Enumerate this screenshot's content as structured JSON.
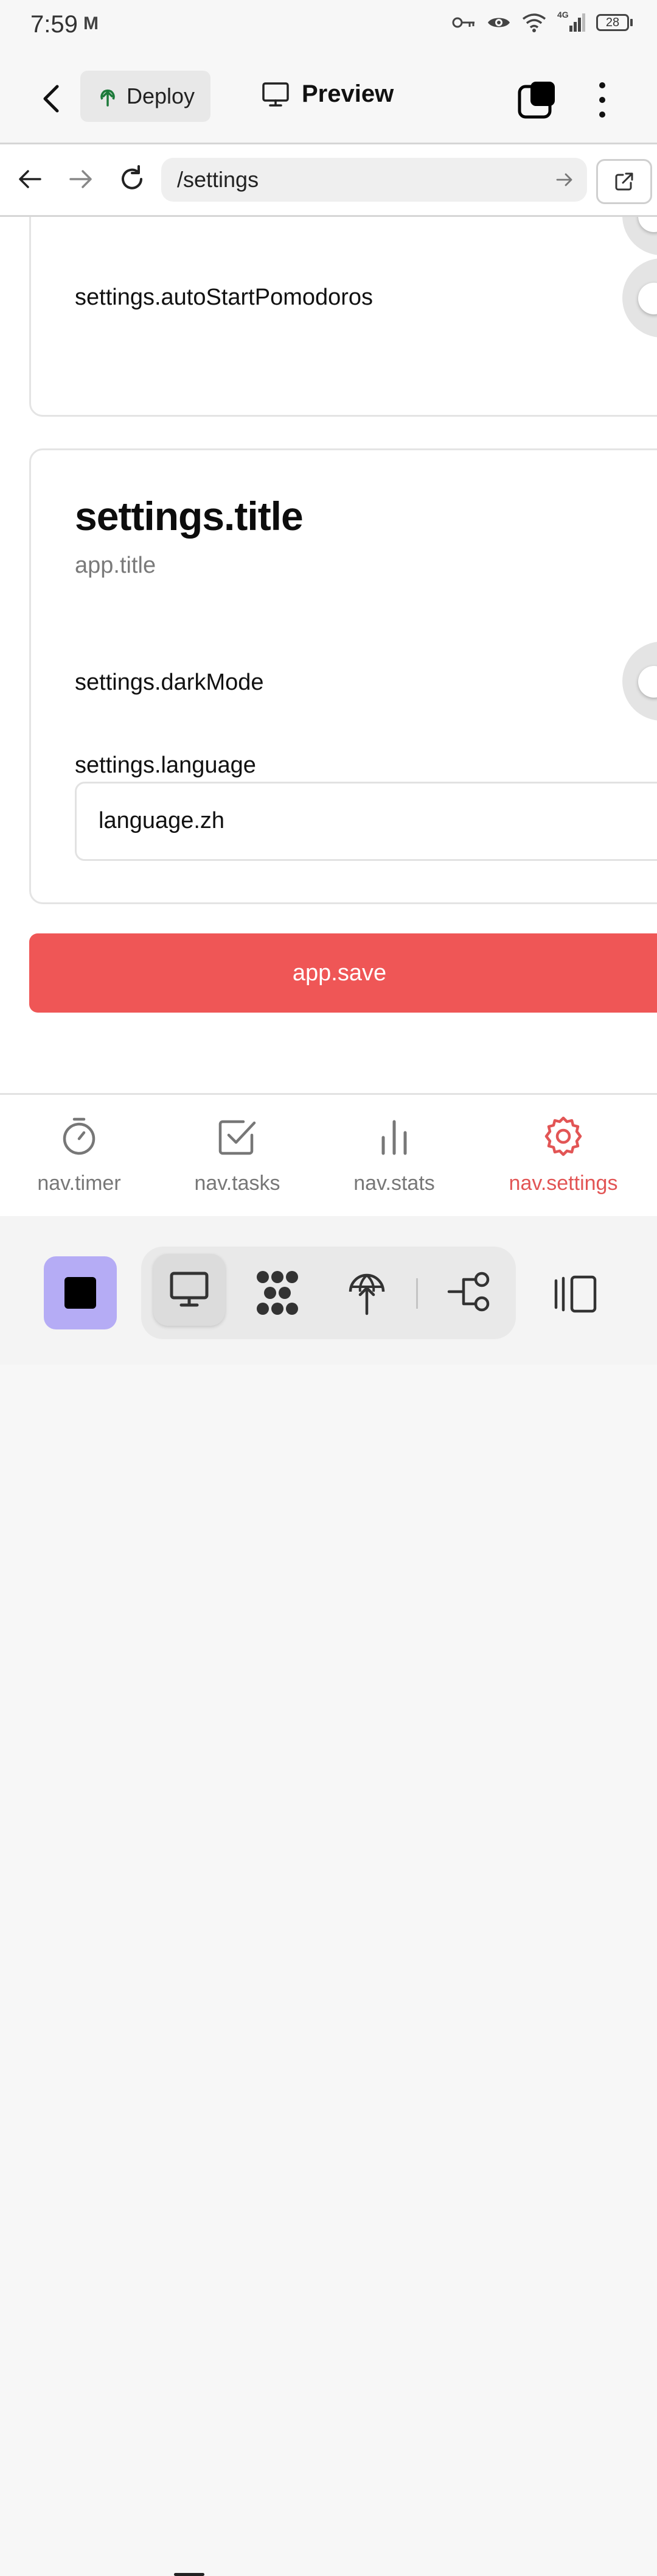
{
  "status_bar": {
    "time": "7:59",
    "mail_glyph": "M",
    "network_label": "4G",
    "battery": "28"
  },
  "app_bar": {
    "deploy_label": "Deploy",
    "preview_label": "Preview"
  },
  "browser": {
    "url": "/settings"
  },
  "card1": {
    "row_label": "settings.autoStartPomodoros"
  },
  "card2": {
    "title": "settings.title",
    "subtitle": "app.title",
    "dark_mode_label": "settings.darkMode",
    "language_label": "settings.language",
    "language_value": "language.zh"
  },
  "save_label": "app.save",
  "tab_nav": {
    "items": [
      {
        "label": "nav.timer",
        "icon": "stopwatch-icon"
      },
      {
        "label": "nav.tasks",
        "icon": "checkbox-icon"
      },
      {
        "label": "nav.stats",
        "icon": "bar-chart-icon"
      },
      {
        "label": "nav.settings",
        "icon": "gear-icon"
      }
    ],
    "active_index": 3
  },
  "colors": {
    "accent": "#ef5656",
    "stop_button": "#b5acf5"
  }
}
